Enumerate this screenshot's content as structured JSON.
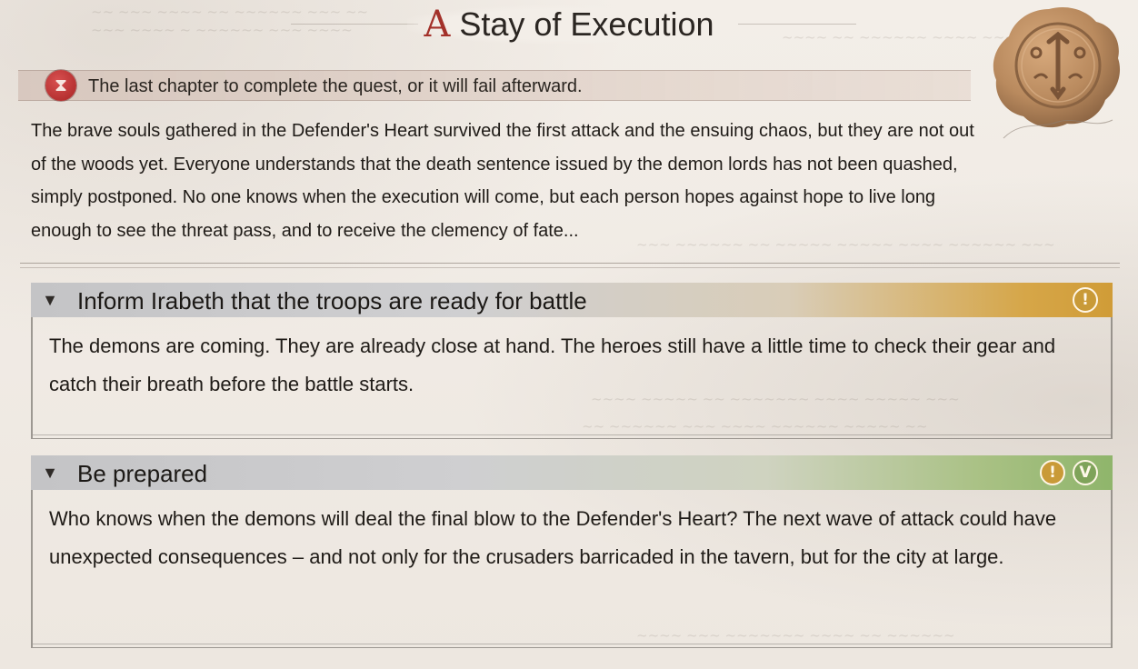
{
  "title": {
    "glyph": "A",
    "text": "Stay of Execution"
  },
  "deadline": {
    "icon": "hourglass-icon",
    "text": "The last chapter to complete the quest, or it will fail afterward."
  },
  "description": "The brave souls gathered in the Defender's Heart survived the first attack and the ensuing chaos, but they are not out of the woods yet. Everyone understands that the death sentence issued by the demon lords has not been quashed, simply postponed. No one knows when the execution will come, but each person hopes against hope to live long enough to see the threat pass, and to receive the clemency of fate...",
  "objectives": [
    {
      "title": "Inform Irabeth that the troops are ready for battle",
      "text": "The demons are coming. They are already close at hand. The heroes still have a little time to check their gear and catch their breath before the battle starts.",
      "status_color": "#d09c37",
      "badges": [
        "!"
      ]
    },
    {
      "title": "Be prepared",
      "text": "Who knows when the demons will deal the final blow to the Defender's Heart? The next wave of attack could have unexpected consequences – and not only for the crusaders barricaded in the tavern, but for the city at large.",
      "status_color": "#8fb56b",
      "badges": [
        "!",
        "V"
      ]
    }
  ],
  "colors": {
    "accent": "#a3312a",
    "seal": "#b98a5e",
    "warn": "#c99a38",
    "done": "#7fa35a"
  }
}
